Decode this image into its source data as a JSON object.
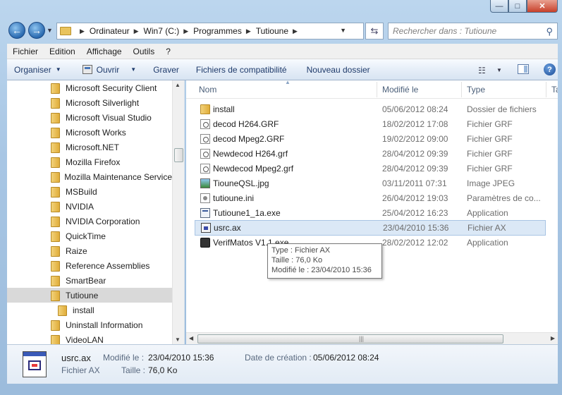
{
  "window": {
    "caption_min": "—",
    "caption_max": "□",
    "caption_close": "✕"
  },
  "address": {
    "crumbs": [
      "Ordinateur",
      "Win7 (C:)",
      "Programmes",
      "Tutioune"
    ],
    "search_placeholder": "Rechercher dans : Tutioune"
  },
  "menu": [
    "Fichier",
    "Edition",
    "Affichage",
    "Outils",
    "?"
  ],
  "commands": {
    "organize": "Organiser",
    "open": "Ouvrir",
    "burn": "Graver",
    "compat": "Fichiers de compatibilité",
    "new_folder": "Nouveau dossier"
  },
  "tree": [
    {
      "label": "Microsoft Security Client",
      "indent": 0
    },
    {
      "label": "Microsoft Silverlight",
      "indent": 0
    },
    {
      "label": "Microsoft Visual Studio",
      "indent": 0
    },
    {
      "label": "Microsoft Works",
      "indent": 0
    },
    {
      "label": "Microsoft.NET",
      "indent": 0
    },
    {
      "label": "Mozilla Firefox",
      "indent": 0
    },
    {
      "label": "Mozilla Maintenance Service",
      "indent": 0
    },
    {
      "label": "MSBuild",
      "indent": 0
    },
    {
      "label": "NVIDIA",
      "indent": 0
    },
    {
      "label": "NVIDIA Corporation",
      "indent": 0
    },
    {
      "label": "QuickTime",
      "indent": 0
    },
    {
      "label": "Raize",
      "indent": 0
    },
    {
      "label": "Reference Assemblies",
      "indent": 0
    },
    {
      "label": "SmartBear",
      "indent": 0
    },
    {
      "label": "Tutioune",
      "indent": 0,
      "selected": true
    },
    {
      "label": "install",
      "indent": 1
    },
    {
      "label": "Uninstall Information",
      "indent": 0
    },
    {
      "label": "VideoLAN",
      "indent": 0
    }
  ],
  "columns": {
    "name": "Nom",
    "modified": "Modifié le",
    "type": "Type",
    "extra": "Ta"
  },
  "files": [
    {
      "name": "install",
      "date": "05/06/2012 08:24",
      "type": "Dossier de fichiers",
      "icon": "folder-icon"
    },
    {
      "name": "decod H264.GRF",
      "date": "18/02/2012 17:08",
      "type": "Fichier GRF",
      "icon": "grf-file-icon"
    },
    {
      "name": "decod Mpeg2.GRF",
      "date": "19/02/2012 09:00",
      "type": "Fichier GRF",
      "icon": "grf-file-icon"
    },
    {
      "name": "Newdecod H264.grf",
      "date": "28/04/2012 09:39",
      "type": "Fichier GRF",
      "icon": "grf-file-icon"
    },
    {
      "name": "Newdecod Mpeg2.grf",
      "date": "28/04/2012 09:39",
      "type": "Fichier GRF",
      "icon": "grf-file-icon"
    },
    {
      "name": "TiouneQSL.jpg",
      "date": "03/11/2011 07:31",
      "type": "Image JPEG",
      "icon": "image-file-icon"
    },
    {
      "name": "tutioune.ini",
      "date": "26/04/2012 19:03",
      "type": "Paramètres de co...",
      "icon": "ini-file-icon"
    },
    {
      "name": "Tutioune1_1a.exe",
      "date": "25/04/2012 16:23",
      "type": "Application",
      "icon": "exe-file-icon"
    },
    {
      "name": "usrc.ax",
      "date": "23/04/2010 15:36",
      "type": "Fichier AX",
      "icon": "ax-file-icon",
      "selected": true
    },
    {
      "name": "VerifMatos V1.1.exe",
      "date": "28/02/2012 12:02",
      "type": "Application",
      "icon": "app-icon"
    }
  ],
  "tooltip": {
    "type_line": "Type : Fichier AX",
    "size_line": "Taille : 76,0 Ko",
    "modified_line": "Modifié le : 23/04/2010 15:36"
  },
  "details": {
    "name": "usrc.ax",
    "type": "Fichier AX",
    "modified_label": "Modifié le :",
    "modified_value": "23/04/2010 15:36",
    "size_label": "Taille :",
    "size_value": "76,0 Ko",
    "created_label": "Date de création :",
    "created_value": "05/06/2012 08:24"
  }
}
